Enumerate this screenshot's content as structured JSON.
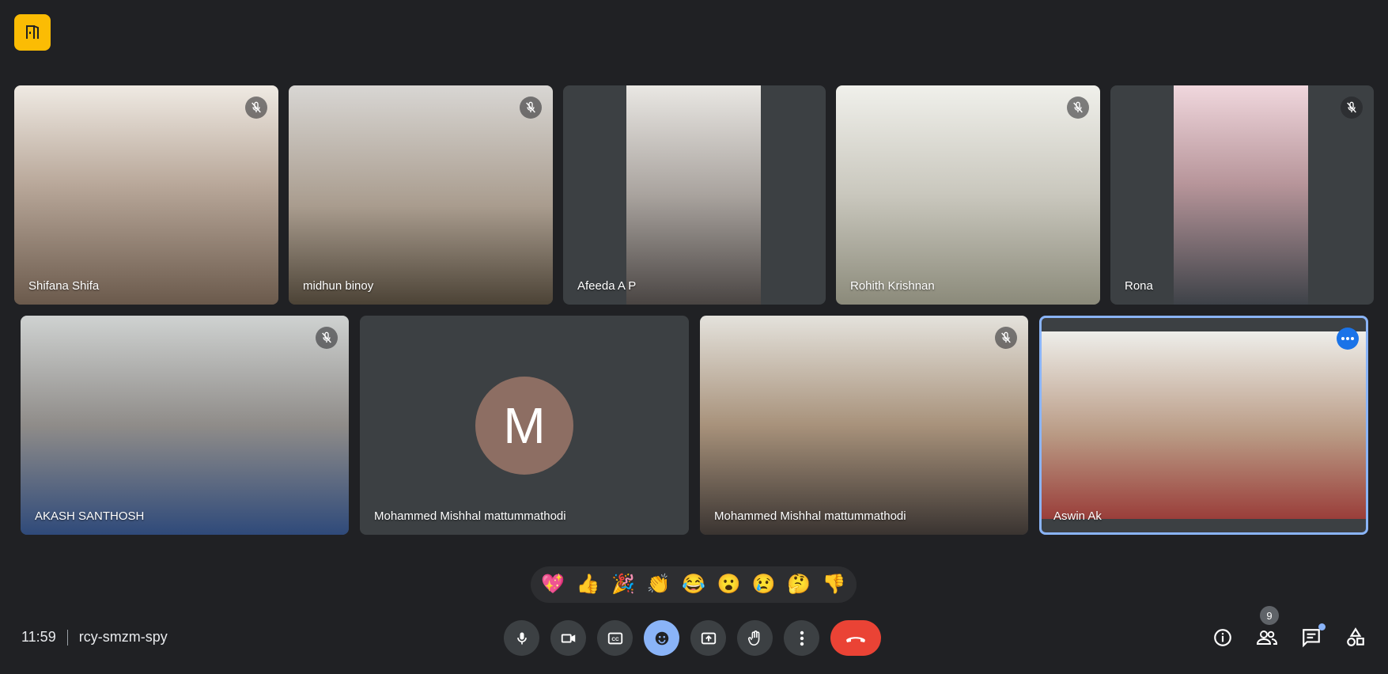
{
  "meeting": {
    "time": "11:59",
    "code": "rcy-smzm-spy",
    "participant_count": "9"
  },
  "tiles": [
    {
      "name": "Shifana Shifa",
      "muted": true
    },
    {
      "name": "midhun binoy",
      "muted": true
    },
    {
      "name": "Afeeda A P",
      "muted": false
    },
    {
      "name": "Rohith Krishnan",
      "muted": true
    },
    {
      "name": "Rona",
      "muted": true
    },
    {
      "name": "AKASH SANTHOSH",
      "muted": true
    },
    {
      "name": "Mohammed Mishhal mattummathodi",
      "avatar_letter": "M",
      "muted": false
    },
    {
      "name": "Mohammed Mishhal mattummathodi",
      "muted": true
    },
    {
      "name": "Aswin Ak",
      "muted": false,
      "active": true
    }
  ],
  "reactions": [
    "💖",
    "👍",
    "🎉",
    "👏",
    "😂",
    "😮",
    "😢",
    "🤔",
    "👎"
  ],
  "colors": {
    "background": "#202124",
    "tile": "#3c4043",
    "accent": "#8ab4f8",
    "hangup": "#ea4335",
    "logo": "#fbbc04",
    "avatar": "#8d6e63"
  },
  "controls": [
    "mic-icon",
    "camera-icon",
    "captions-icon",
    "emoji-icon",
    "present-icon",
    "raise-hand-icon",
    "more-options-icon",
    "hang-up-icon"
  ],
  "right_icons": [
    "info-icon",
    "people-icon",
    "chat-icon",
    "activities-icon"
  ]
}
